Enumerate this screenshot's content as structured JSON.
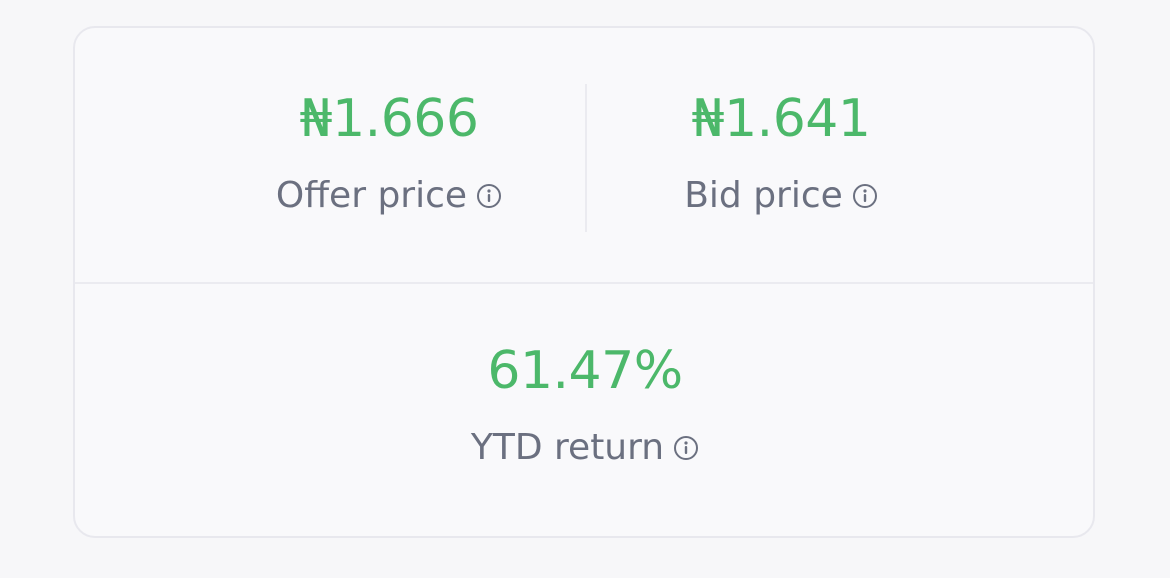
{
  "stats": {
    "offer": {
      "value": "₦1.666",
      "label": "Offer price",
      "icon": "info-icon"
    },
    "bid": {
      "value": "₦1.641",
      "label": "Bid price",
      "icon": "info-icon"
    },
    "ytd": {
      "value": "61.47%",
      "label": "YTD return",
      "icon": "info-icon"
    }
  },
  "colors": {
    "accent_green": "#4cb86a",
    "label_gray": "#6b7080",
    "card_border": "#e8e8ee",
    "background": "#f7f7f9"
  }
}
